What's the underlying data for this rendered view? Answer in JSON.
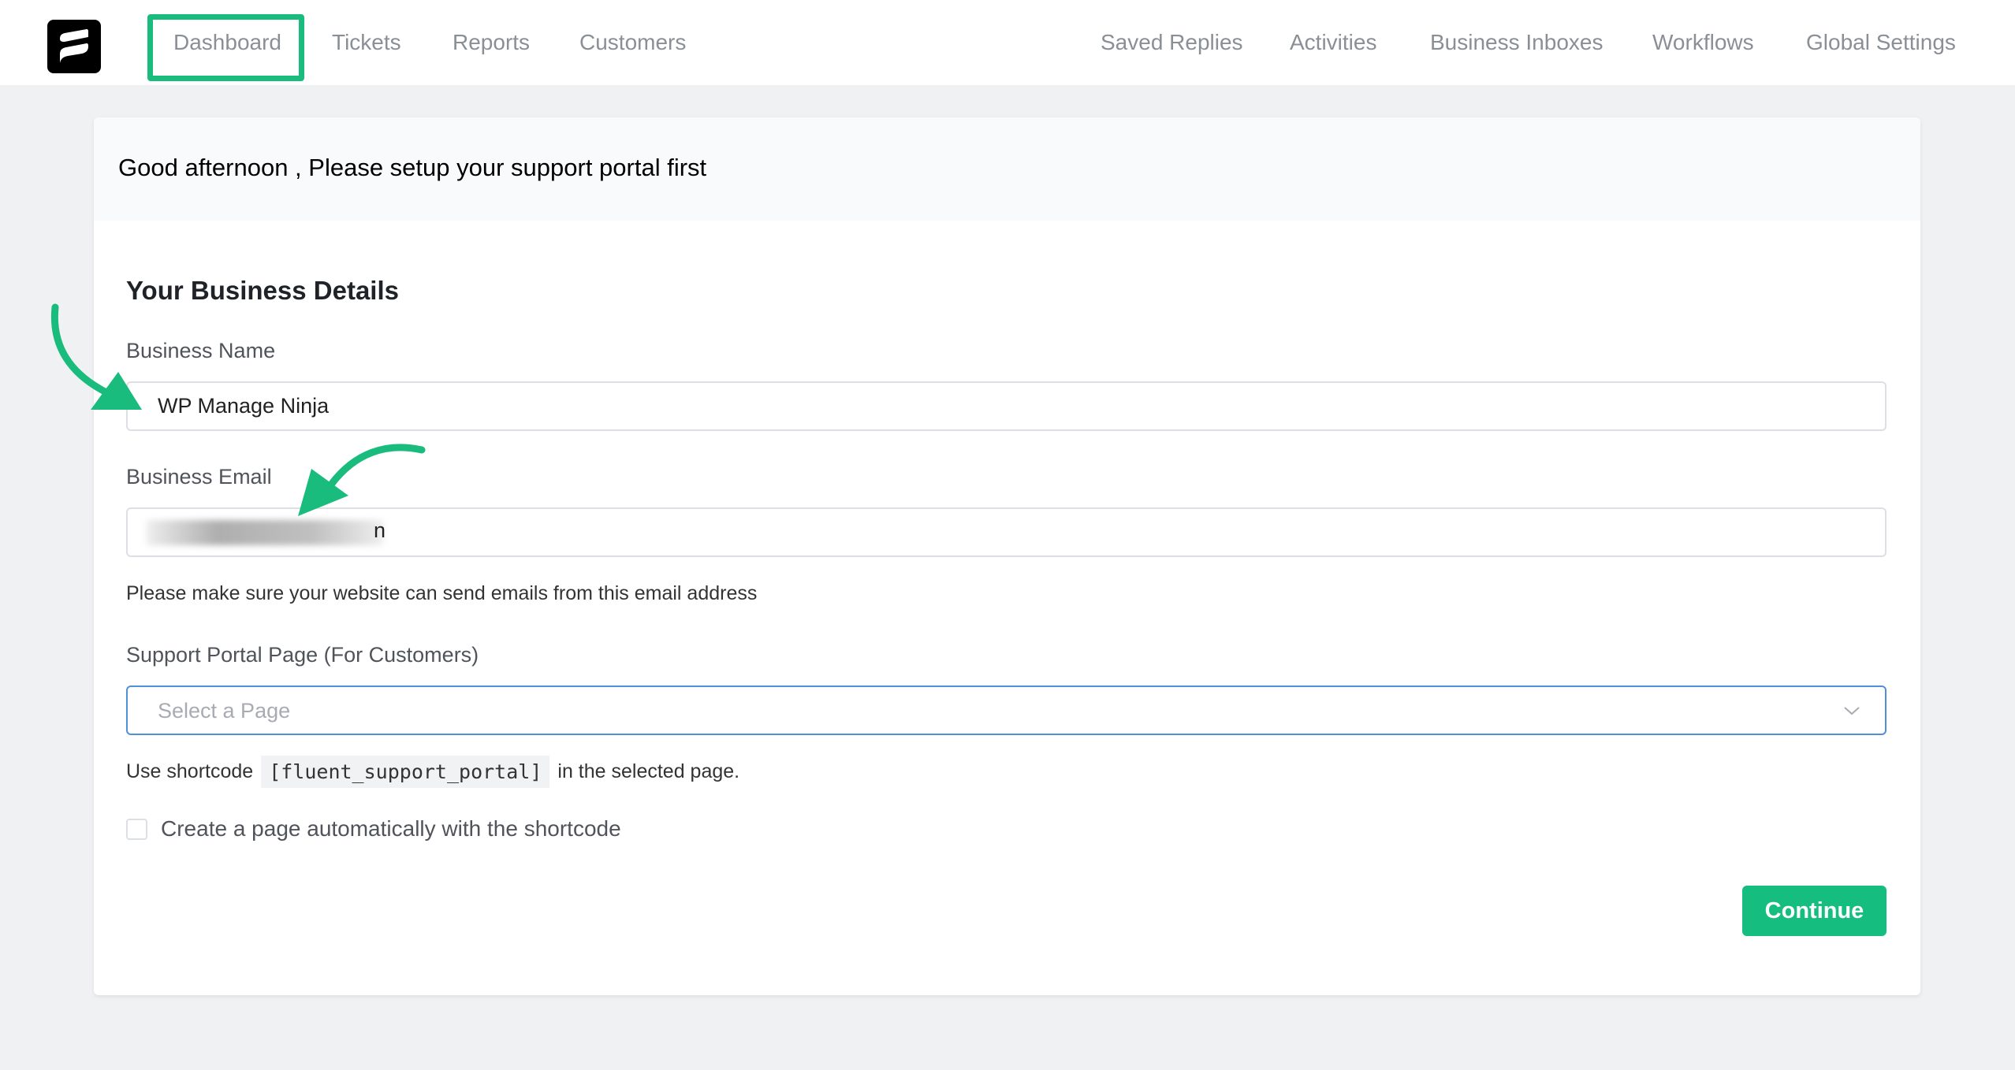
{
  "nav": {
    "logo": "fluent-support-logo",
    "left_items": [
      {
        "label": "Dashboard",
        "active": true
      },
      {
        "label": "Tickets"
      },
      {
        "label": "Reports"
      },
      {
        "label": "Customers"
      }
    ],
    "right_items": [
      {
        "label": "Saved Replies"
      },
      {
        "label": "Activities"
      },
      {
        "label": "Business Inboxes"
      },
      {
        "label": "Workflows"
      },
      {
        "label": "Global Settings"
      }
    ]
  },
  "card": {
    "header_title": "Good afternoon , Please setup your support portal first",
    "section_title": "Your Business Details",
    "business_name": {
      "label": "Business Name",
      "value": "WP Manage Ninja"
    },
    "business_email": {
      "label": "Business Email",
      "value_visible_tail": "n",
      "redacted": true
    },
    "email_helper": "Please make sure your website can send emails from this email address",
    "portal_page": {
      "label": "Support Portal Page (For Customers)",
      "placeholder": "Select a Page"
    },
    "shortcode": {
      "prefix": "Use shortcode",
      "code": "[fluent_support_portal]",
      "suffix": "in the selected page."
    },
    "auto_create": {
      "label": "Create a page automatically with the shortcode",
      "checked": false
    },
    "continue_label": "Continue"
  },
  "colors": {
    "accent_green": "#15bd7f",
    "annotation_green": "#19bc7d",
    "focus_blue": "#4f8fdb"
  }
}
